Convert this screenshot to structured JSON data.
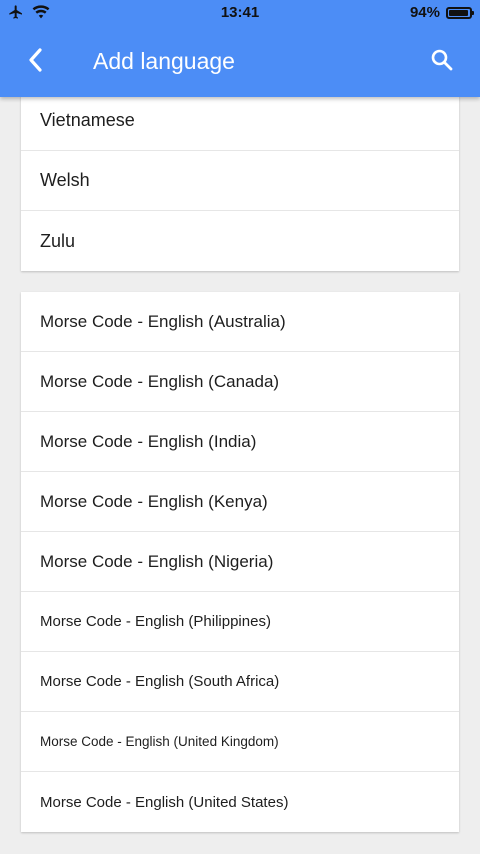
{
  "status_bar": {
    "time": "13:41",
    "battery_pct_label": "94%",
    "battery_level": 0.94,
    "icons": [
      "airplane-icon",
      "wifi-icon",
      "battery-icon"
    ]
  },
  "app_bar": {
    "title": "Add language",
    "background": "#4C8DF6",
    "icons": [
      "back-chevron-icon",
      "search-icon"
    ]
  },
  "recent_languages": [
    {
      "label": "Vietnamese"
    },
    {
      "label": "Welsh"
    },
    {
      "label": "Zulu"
    }
  ],
  "morse_languages": [
    {
      "label": "Morse Code - English (Australia)"
    },
    {
      "label": "Morse Code - English (Canada)"
    },
    {
      "label": "Morse Code - English (India)"
    },
    {
      "label": "Morse Code - English (Kenya)"
    },
    {
      "label": "Morse Code - English (Nigeria)"
    },
    {
      "label": "Morse Code - English (Philippines)"
    },
    {
      "label": "Morse Code - English (South Africa)"
    },
    {
      "label": "Morse Code - English (United Kingdom)"
    },
    {
      "label": "Morse Code - English (United States)"
    }
  ]
}
